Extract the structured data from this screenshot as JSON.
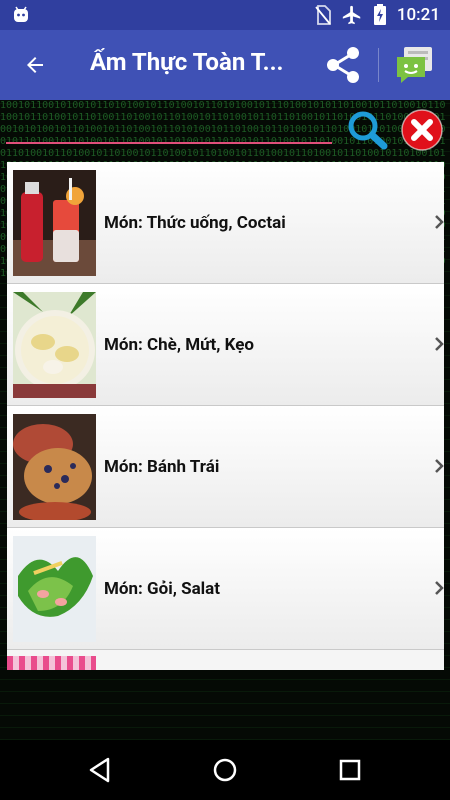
{
  "status_bar": {
    "time": "10:21"
  },
  "app_bar": {
    "title": "Ẩm Thực Toàn T..."
  },
  "search": {
    "value": "",
    "placeholder": ""
  },
  "background_binary": "1001011001010010110101001011010010110101001011101001010110100101101001011010010110100101101001101001011010010110100101101101001011010010110100101101001010100101101001011010010110101001011010010110100101101001011010010110100101101001011010010110100101101001011010010110100101101001011010010110100101101001011010010110100101101001011010010110100101101001011010010110100101101001011010010110100101101001011010010110100101101001011010010110100101101001011010010110100101101001011010010110100101101001011010010110100101101001011010010110100101101001011010010110100101101001011010010110100101101001011010010110100101101001011010010110100101101001011010010110100101101001011010010110100101101001011010010110100101101001011010010110100101101001011010010110100101101001011010010110100101101001011010010110100101101001011010010110100101101001011010010110100101101001011010010110100101101001011010010110100101101001011010010110100101101001011010010110100101101001011010010110100101101001011010010110100101101001011010010110100101101001011010010110100101101001011010010110100101101001011010010110100101101001",
  "list": {
    "items": [
      {
        "label": "Món: Thức uống, Coctai",
        "image": "cocktail-drinks"
      },
      {
        "label": "Món: Chè, Mứt, Kẹo",
        "image": "sweet-soup-bowl"
      },
      {
        "label": "Món: Bánh Trái",
        "image": "muffins"
      },
      {
        "label": "Món: Gỏi, Salat",
        "image": "salad"
      }
    ]
  },
  "colors": {
    "status_bar": "#303f9f",
    "app_bar": "#3f51b5",
    "search_underline": "#e04f7b",
    "search_icon": "#1e9bd7",
    "clear_icon": "#e0101a"
  }
}
